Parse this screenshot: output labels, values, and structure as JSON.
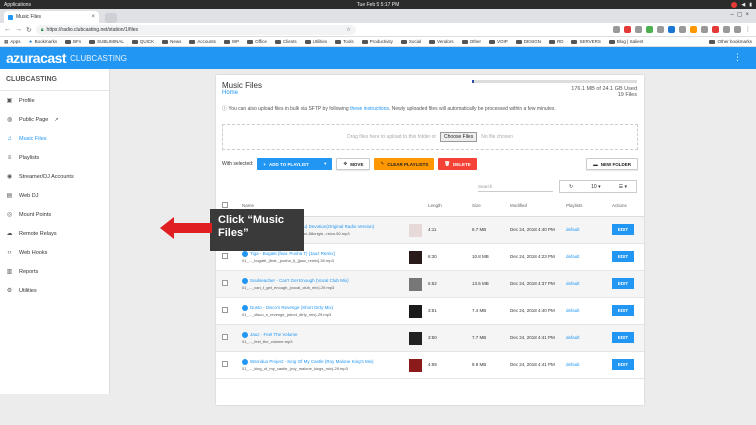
{
  "os": {
    "menu": "Applications",
    "clock": "Tue Feb 5    5:17 PM"
  },
  "browser": {
    "tab_title": "Music Files",
    "url": "https://radio.clubcasting.net/station/1/files",
    "bookmarks": [
      "Apps",
      "Bookmarks",
      "BFs",
      "SUBLIMINAL",
      "QUICK",
      "News",
      "Accounts",
      "WP",
      "Office",
      "Clients",
      "Utilities",
      "Tools",
      "Productivity",
      "Social",
      "Vendors",
      "Other",
      "VOIP",
      "DESIGN",
      "RD",
      "SERVERS",
      "Blog | Salient"
    ],
    "other_bookmarks": "Other bookmarks"
  },
  "header": {
    "logo": "azuracast",
    "station": "CLUBCASTING"
  },
  "sidebar": {
    "title": "CLUBCASTING",
    "items": [
      {
        "label": "Profile",
        "icon": "user-icon"
      },
      {
        "label": "Public Page",
        "icon": "globe-icon"
      },
      {
        "label": "Music Files",
        "icon": "music-library-icon"
      },
      {
        "label": "Playlists",
        "icon": "playlist-icon"
      },
      {
        "label": "Streamer/DJ Accounts",
        "icon": "broadcast-icon"
      },
      {
        "label": "Web DJ",
        "icon": "headset-icon"
      },
      {
        "label": "Mount Points",
        "icon": "wifi-icon"
      },
      {
        "label": "Remote Relays",
        "icon": "cloud-upload-icon"
      },
      {
        "label": "Web Hooks",
        "icon": "code-icon"
      },
      {
        "label": "Reports",
        "icon": "report-icon"
      },
      {
        "label": "Utilities",
        "icon": "gear-icon"
      }
    ]
  },
  "callout": {
    "text": "Click “Music Files”"
  },
  "page": {
    "title": "Music Files",
    "breadcrumb": "Home",
    "usage_text": "176.1 MB of 24.1 GB Used",
    "usage_fraction": 0.007,
    "files_count": "19 Files",
    "info_prefix": "You can also upload files in bulk via SFTP by following",
    "info_link": "these instructions",
    "info_suffix": ". Newly uploaded files will automatically be processed within a few minutes.",
    "drop_text": "Drag files here to upload to this folder or",
    "choose_label": "Choose Files",
    "no_file": "No file chosen",
    "with_selected": "With selected:",
    "add_to_playlist": "ADD TO PLAYLIST",
    "move": "MOVE",
    "clear_playlists": "CLEAR PLAYLISTS",
    "delete": "DELETE",
    "new_folder": "NEW FOLDER",
    "search_placeholder": "Search",
    "page_size": "10",
    "columns": [
      "Name",
      "Length",
      "Size",
      "Modified",
      "Playlists",
      "Actions"
    ],
    "rows": [
      {
        "title": "Nomad - (I Wanna Give You) Devotion(Original Radio Version)",
        "file": "01_..._(i_wanna_give_you)_devotion-58origin...rsion-50.mp3",
        "length": "4:11",
        "size": "8.7 MB",
        "modified": "Dec 24, 2018 4:40 PM",
        "playlist": "default",
        "thumb": "#e8d9d9"
      },
      {
        "title": "Tiga - Bugatti (feat. Pusha T) [Jauz Remix]",
        "file": "01_..._bugatti_(feat._pusha_t)_[jauz_remix]-50.mp3",
        "length": "6:30",
        "size": "10.8 MB",
        "modified": "Dec 24, 2018 4:23 PM",
        "playlist": "default",
        "thumb": "#2a1a1a"
      },
      {
        "title": "Soulseacher - Can't Get Enough (Vocal Club Mix)",
        "file": "01_..._can_t_get_enough_(vocal_club_mix)-29.mp3",
        "length": "6:52",
        "size": "13.6 MB",
        "modified": "Dec 24, 2018 4:37 PM",
        "playlist": "default",
        "thumb": "#777777"
      },
      {
        "title": "Dusto - Disco's Revenge (Short Dirty Mix)",
        "file": "01_..._disco_s_revenge_(short_dirty_mix)-29.mp3",
        "length": "3:51",
        "size": "7.4 MB",
        "modified": "Dec 24, 2018 4:40 PM",
        "playlist": "default",
        "thumb": "#1a1a1a"
      },
      {
        "title": "Jauz - Feel The Volume",
        "file": "01_..._feel_the_volume.mp3",
        "length": "3:50",
        "size": "7.7 MB",
        "modified": "Dec 24, 2018 4:41 PM",
        "playlist": "default",
        "thumb": "#222222"
      },
      {
        "title": "Warriduo Project - King Of My Castle (Roy Malone King's Mix)",
        "file": "01_..._king_of_my_castle_(roy_malone_kings_mix)-29.mp3",
        "length": "4:59",
        "size": "8.9 MB",
        "modified": "Dec 24, 2018 4:41 PM",
        "playlist": "default",
        "thumb": "#8b1a1a"
      }
    ],
    "edit_label": "EDIT"
  },
  "colors": {
    "primary": "#2196f3",
    "accent_orange": "#ff9800",
    "danger": "#f44336",
    "callout_arrow": "#e02020"
  }
}
